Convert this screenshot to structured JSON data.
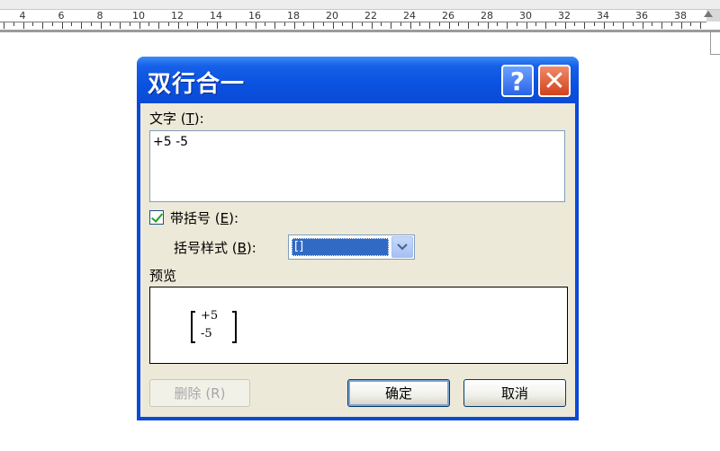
{
  "ruler": {
    "labels": [
      "4",
      "6",
      "8",
      "10",
      "12",
      "14",
      "16",
      "18",
      "20",
      "22",
      "24",
      "26",
      "28",
      "30",
      "32",
      "34",
      "36",
      "38"
    ]
  },
  "dialog": {
    "title": "双行合一",
    "help_icon": "help-icon",
    "close_icon": "close-icon",
    "text_label": "文字 (",
    "text_key": "T",
    "text_label_end": "):",
    "text_value": "+5 -5",
    "bracket_checkbox_label": "带括号 (",
    "bracket_key": "E",
    "bracket_label_end": "):",
    "bracket_checked": true,
    "bracket_style_label": "括号样式 (",
    "bracket_style_key": "B",
    "bracket_style_label_end": "):",
    "bracket_style_value": "[]",
    "preview_label": "预览",
    "preview_lines": [
      "+5",
      "-5"
    ],
    "delete_button": "删除 (R)",
    "ok_button": "确定",
    "cancel_button": "取消"
  },
  "colors": {
    "title_bar": "#0a52e0",
    "dialog_face": "#ece9d8",
    "selection": "#316ac5"
  }
}
